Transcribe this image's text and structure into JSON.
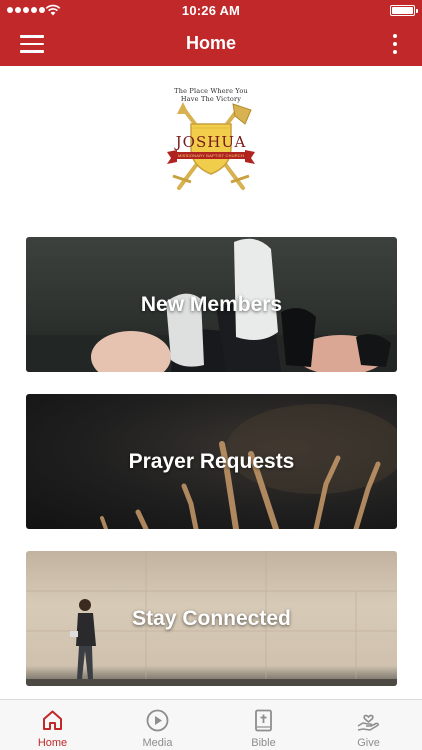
{
  "status_bar": {
    "time": "10:26 AM",
    "signal_icon": "signal-dots-icon",
    "wifi_icon": "wifi-icon",
    "battery_icon": "battery-icon"
  },
  "nav": {
    "title": "Home",
    "menu_icon": "hamburger-menu-icon",
    "more_icon": "more-vertical-icon",
    "color": "#c0282a"
  },
  "logo": {
    "tagline_line1": "The Place Where You",
    "tagline_line2": "Have The Victory",
    "wordmark": "JOSHUA",
    "subtitle": "MISSIONARY BAPTIST CHURCH"
  },
  "cards": [
    {
      "label": "New Members"
    },
    {
      "label": "Prayer Requests"
    },
    {
      "label": "Stay Connected"
    }
  ],
  "tabs": [
    {
      "label": "Home",
      "icon": "home-icon",
      "active": true
    },
    {
      "label": "Media",
      "icon": "play-circle-icon",
      "active": false
    },
    {
      "label": "Bible",
      "icon": "bible-icon",
      "active": false
    },
    {
      "label": "Give",
      "icon": "give-hand-heart-icon",
      "active": false
    }
  ],
  "colors": {
    "accent": "#c0282a",
    "tab_inactive": "#8e8e8e",
    "background": "#ffffff"
  }
}
